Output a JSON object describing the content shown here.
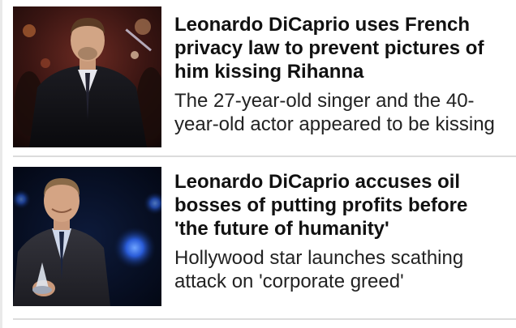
{
  "articles": [
    {
      "headline": "Leonardo DiCaprio uses French privacy law to prevent pictures of him kissing Rihanna",
      "summary": "The 27-year-old singer and the 40-year-old actor appeared to be kissing",
      "thumbnail": "red-carpet-photo"
    },
    {
      "headline": "Leonardo DiCaprio accuses oil bosses of putting profits before 'the future of humanity'",
      "summary": "Hollywood star launches scathing attack on 'corporate greed'",
      "thumbnail": "award-stage-photo"
    }
  ],
  "colors": {
    "headline": "#111111",
    "summary": "#222222",
    "divider": "#dcdcdc"
  }
}
